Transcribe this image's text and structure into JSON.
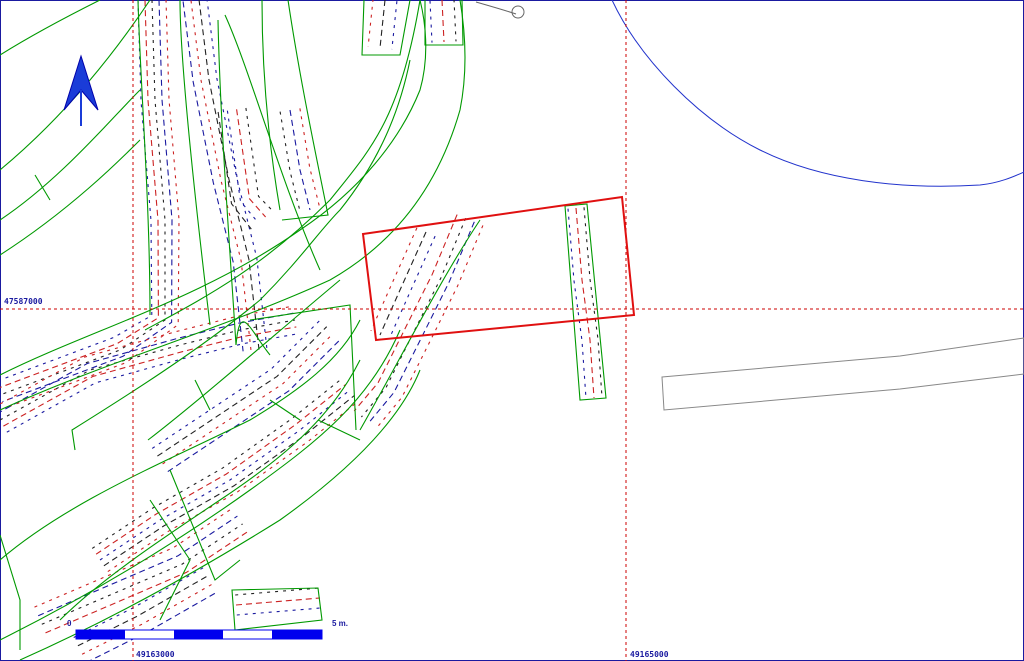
{
  "map": {
    "coordinates": {
      "northing": "47587000",
      "easting_left": "49163000",
      "easting_right": "49165000"
    },
    "scale_bar": {
      "start_label": "0",
      "end_label": "5 m.",
      "segments": 5
    },
    "north_arrow": "north-arrow-icon",
    "colors": {
      "grid": "#cc0000",
      "parcel_outline": "#009900",
      "selection": "#e01010",
      "water": "#2233cc",
      "coord_text": "#1a1aa0",
      "road": "#888888",
      "scale_bar": "#0000ee"
    }
  }
}
